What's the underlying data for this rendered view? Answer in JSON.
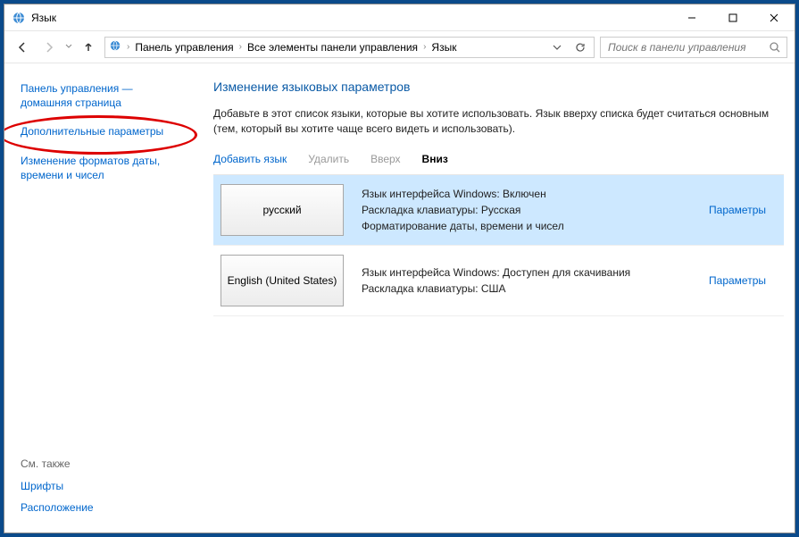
{
  "titlebar": {
    "title": "Язык"
  },
  "breadcrumbs": {
    "c0": "Панель управления",
    "c1": "Все элементы панели управления",
    "c2": "Язык"
  },
  "search": {
    "placeholder": "Поиск в панели управления"
  },
  "sidebar": {
    "home": "Панель управления — домашняя страница",
    "advanced": "Дополнительные параметры",
    "formats": "Изменение форматов даты, времени и чисел",
    "see_also": "См. также",
    "fonts": "Шрифты",
    "location": "Расположение"
  },
  "main": {
    "heading": "Изменение языковых параметров",
    "desc": "Добавьте в этот список языки, которые вы хотите использовать. Язык вверху списка будет считаться основным (тем, который вы хотите чаще всего видеть и использовать).",
    "toolbar": {
      "add": "Добавить язык",
      "remove": "Удалить",
      "up": "Вверх",
      "down": "Вниз"
    },
    "params_label": "Параметры",
    "langs": [
      {
        "box": "русский",
        "l1": "Язык интерфейса Windows: Включен",
        "l2": "Раскладка клавиатуры: Русская",
        "l3": "Форматирование даты, времени и чисел"
      },
      {
        "box": "English (United States)",
        "l1": "Язык интерфейса Windows: Доступен для скачивания",
        "l2": "Раскладка клавиатуры: США",
        "l3": ""
      }
    ]
  }
}
